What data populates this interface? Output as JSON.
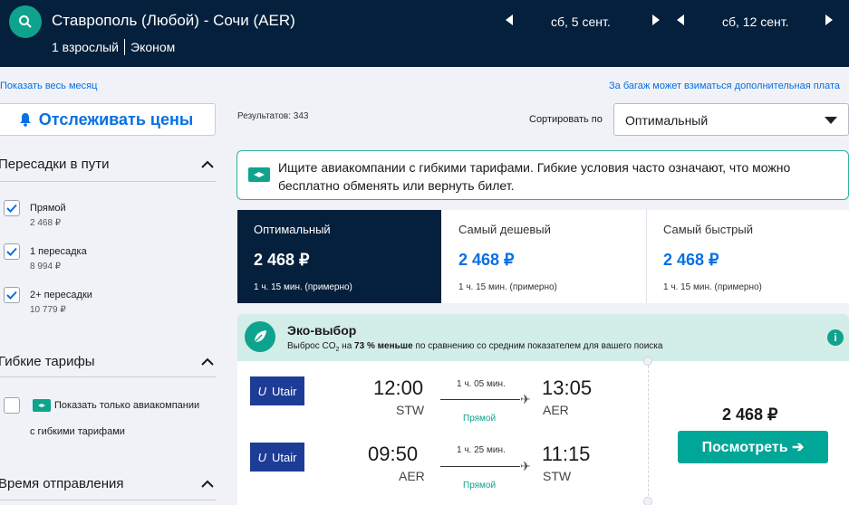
{
  "header": {
    "route": "Ставрополь (Любой) - Сочи (AER)",
    "passengers": "1 взрослый",
    "cabin": "Эконом",
    "depart_date": "сб, 5 сент.",
    "return_date": "сб, 12 сент."
  },
  "links": {
    "show_month": "Показать весь месяц",
    "baggage_note": "За багаж может взиматься дополнительная плата"
  },
  "track_prices": "Отслеживать цены",
  "filters": {
    "stops_title": "Пересадки в пути",
    "stops": [
      {
        "label": "Прямой",
        "price": "2 468 ₽",
        "checked": true
      },
      {
        "label": "1 пересадка",
        "price": "8 994 ₽",
        "checked": true
      },
      {
        "label": "2+ пересадки",
        "price": "10 779 ₽",
        "checked": true
      }
    ],
    "flex_title": "Гибкие тарифы",
    "flex_option_line1": "Показать только авиакомпании",
    "flex_option_line2": "с гибкими тарифами",
    "departure_title": "Время отправления"
  },
  "results_count": "Результатов: 343",
  "sort": {
    "label": "Сортировать по",
    "value": "Оптимальный"
  },
  "info_banner": "Ищите авиакомпании с гибкими тарифами. Гибкие условия часто означают, что можно бесплатно обменять или вернуть билет.",
  "tabs": [
    {
      "name": "Оптимальный",
      "price": "2 468 ₽",
      "duration": "1 ч. 15 мин. (примерно)"
    },
    {
      "name": "Самый дешевый",
      "price": "2 468 ₽",
      "duration": "1 ч. 15 мин. (примерно)"
    },
    {
      "name": "Самый быстрый",
      "price": "2 468 ₽",
      "duration": "1 ч. 15 мин. (примерно)"
    }
  ],
  "eco": {
    "title": "Эко-выбор",
    "text_pre": "Выброс CO",
    "text_sub": "2",
    "text_mid": " на ",
    "text_bold": "73 % меньше",
    "text_post": " по сравнению со средним показателем для вашего поиска",
    "info": "i"
  },
  "card": {
    "legs": [
      {
        "airline": "Utair",
        "dep_time": "12:00",
        "dep_code": "STW",
        "duration": "1 ч. 05 мин.",
        "stops": "Прямой",
        "arr_time": "13:05",
        "arr_code": "AER"
      },
      {
        "airline": "Utair",
        "dep_time": "09:50",
        "dep_code": "AER",
        "duration": "1 ч. 25 мин.",
        "stops": "Прямой",
        "arr_time": "11:15",
        "arr_code": "STW"
      }
    ],
    "price": "2 468 ₽",
    "button": "Посмотреть ➔"
  },
  "colors": {
    "navy": "#05203c",
    "teal": "#0fa38d",
    "blue": "#0770e3"
  }
}
